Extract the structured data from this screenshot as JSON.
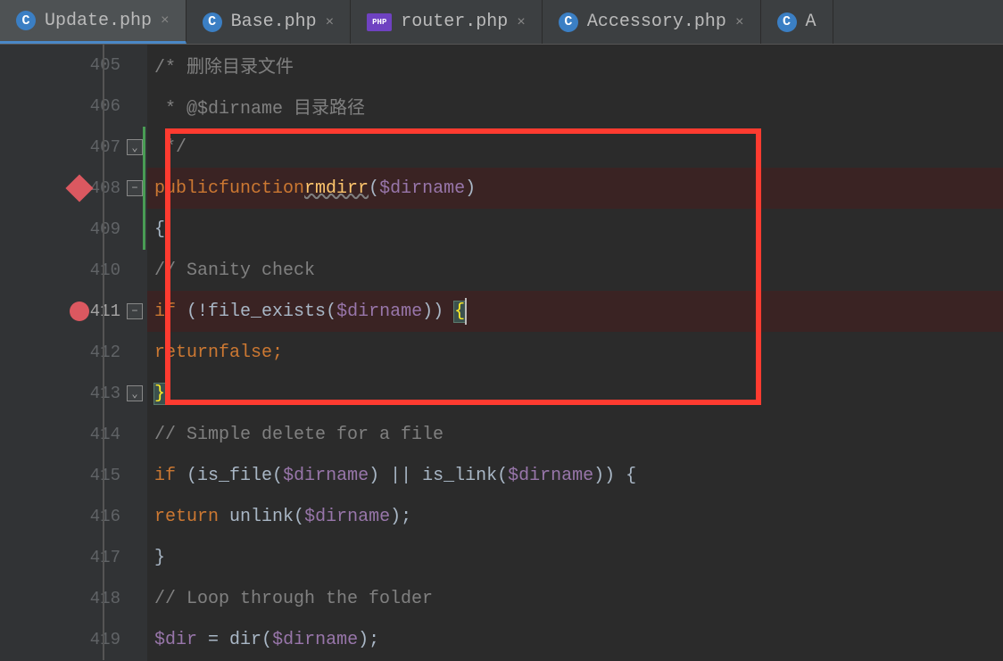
{
  "tabs": [
    {
      "label": "Update.php",
      "icon": "c",
      "active": true
    },
    {
      "label": "Base.php",
      "icon": "c",
      "active": false
    },
    {
      "label": "router.php",
      "icon": "php",
      "active": false
    },
    {
      "label": "Accessory.php",
      "icon": "c",
      "active": false
    },
    {
      "label": "A",
      "icon": "c",
      "active": false,
      "partial": true
    }
  ],
  "lines": {
    "l405": {
      "num": "405",
      "comment": "/* 删除目录文件"
    },
    "l406": {
      "num": "406",
      "comment": " * @$dirname 目录路径"
    },
    "l407": {
      "num": "407",
      "comment": " */"
    },
    "l408": {
      "num": "408",
      "kw1": "public",
      "kw2": "function",
      "fn": "rmdirr",
      "p1": "(",
      "var": "$dirname",
      "p2": ")"
    },
    "l409": {
      "num": "409",
      "brace": "{"
    },
    "l410": {
      "num": "410",
      "comment": "// Sanity check"
    },
    "l411": {
      "num": "411",
      "kw": "if",
      "p1": " (!",
      "fn": "file_exists",
      "p2": "(",
      "var": "$dirname",
      "p3": ")) ",
      "brace": "{"
    },
    "l412": {
      "num": "412",
      "kw": "return",
      "kw2": "false",
      "sc": ";"
    },
    "l413": {
      "num": "413",
      "brace": "}"
    },
    "l414": {
      "num": "414",
      "comment": "// Simple delete for a file"
    },
    "l415": {
      "num": "415",
      "kw": "if",
      "p1": " (",
      "fn1": "is_file",
      "p2": "(",
      "var1": "$dirname",
      "p3": ") || ",
      "fn2": "is_link",
      "p4": "(",
      "var2": "$dirname",
      "p5": ")) {"
    },
    "l416": {
      "num": "416",
      "kw": "return",
      "sp": " ",
      "fn": "unlink",
      "p1": "(",
      "var": "$dirname",
      "p2": ");"
    },
    "l417": {
      "num": "417",
      "brace": "}"
    },
    "l418": {
      "num": "418",
      "comment": "// Loop through the folder"
    },
    "l419": {
      "num": "419",
      "var1": "$dir",
      "op": " = ",
      "fn": "dir",
      "p1": "(",
      "var2": "$dirname",
      "p2": ");"
    }
  }
}
